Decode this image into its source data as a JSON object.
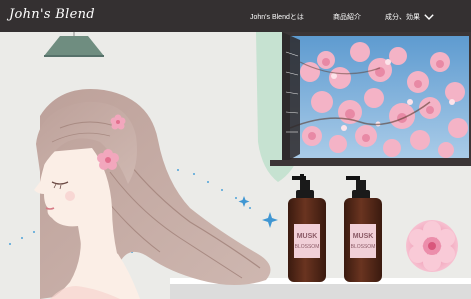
{
  "header": {
    "logo_text": "John's Blend",
    "nav": [
      {
        "label": "John's Blendとは"
      },
      {
        "label": "商品紹介"
      },
      {
        "label": "成分、効果"
      }
    ]
  },
  "product_bottles": [
    {
      "label_line1": "MUSK",
      "label_line2": "BLOSSOM"
    },
    {
      "label_line1": "MUSK",
      "label_line2": "BLOSSOM"
    }
  ],
  "colors": {
    "nav_bg": "#343031",
    "wall": "#eeeeec",
    "hair": "#c4aba3",
    "blossom_pink": "#f2a7bd",
    "sky": "#6aa6d8",
    "bottle": "#4a2416"
  },
  "icons": [
    "chevron-down-icon",
    "flower-icon",
    "sparkle-icon"
  ]
}
